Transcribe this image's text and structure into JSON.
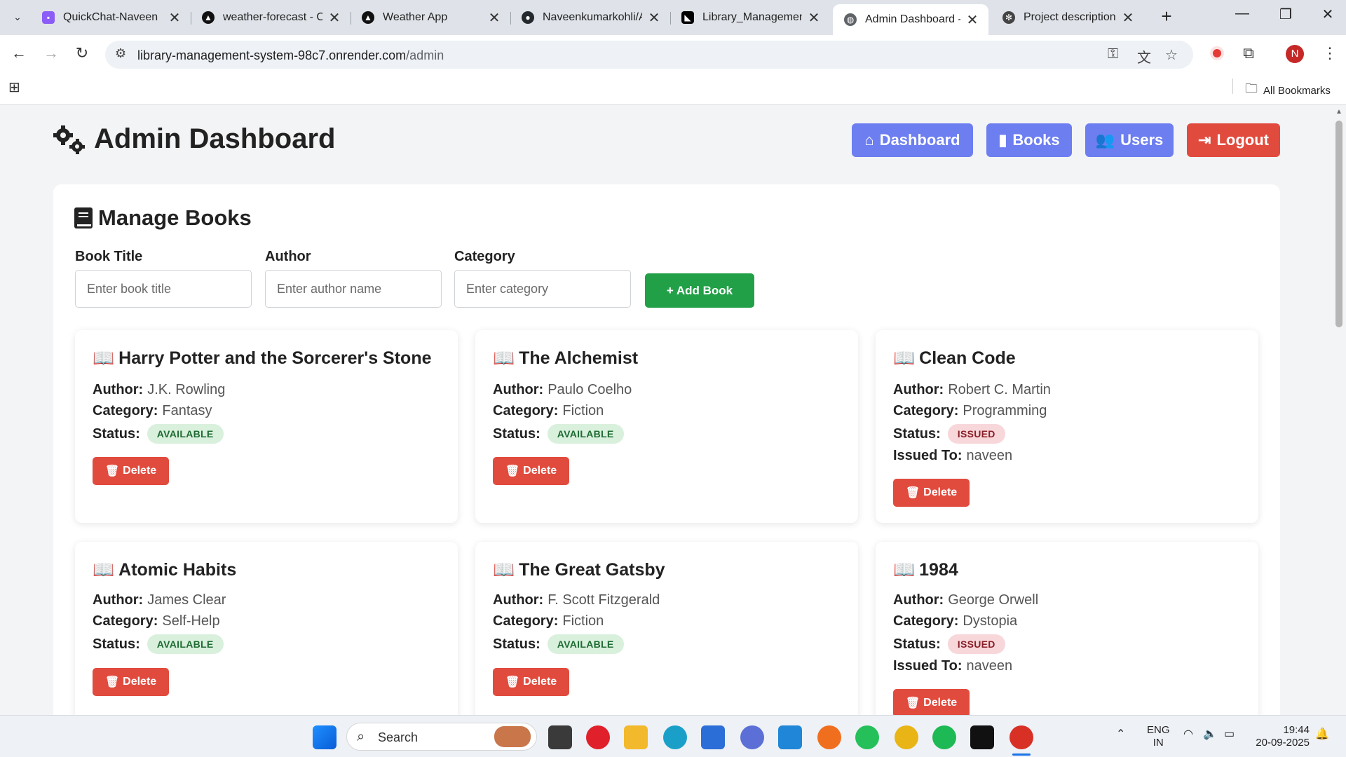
{
  "browser": {
    "tabs": [
      {
        "title": "QuickChat-Naveen",
        "icon": "chat-icon"
      },
      {
        "title": "weather-forecast - O",
        "icon": "vercel-icon"
      },
      {
        "title": "Weather App",
        "icon": "vercel-icon"
      },
      {
        "title": "Naveenkumarkohli/A",
        "icon": "github-icon"
      },
      {
        "title": "Library_Management",
        "icon": "render-icon"
      },
      {
        "title": "Admin Dashboard - L",
        "icon": "globe-icon",
        "active": true
      },
      {
        "title": "Project description re",
        "icon": "openai-icon"
      }
    ],
    "url_host": "library-management-system-98c7.onrender.com",
    "url_path": "/admin",
    "profile_initial": "N",
    "bookmarks_label": "All Bookmarks"
  },
  "header": {
    "title": "Admin Dashboard",
    "nav": {
      "dashboard": "Dashboard",
      "books": "Books",
      "users": "Users",
      "logout": "Logout"
    }
  },
  "manage": {
    "title": "Manage Books",
    "fields": {
      "title_label": "Book Title",
      "title_placeholder": "Enter book title",
      "author_label": "Author",
      "author_placeholder": "Enter author name",
      "category_label": "Category",
      "category_placeholder": "Enter category"
    },
    "add_button": "Add Book",
    "labels": {
      "author": "Author:",
      "category": "Category:",
      "status": "Status:",
      "issued_to": "Issued To:",
      "delete": "Delete"
    },
    "books": [
      {
        "title": "Harry Potter and the Sorcerer's Stone",
        "author": "J.K. Rowling",
        "category": "Fantasy",
        "status": "AVAILABLE"
      },
      {
        "title": "The Alchemist",
        "author": "Paulo Coelho",
        "category": "Fiction",
        "status": "AVAILABLE"
      },
      {
        "title": "Clean Code",
        "author": "Robert C. Martin",
        "category": "Programming",
        "status": "ISSUED",
        "issued_to": "naveen"
      },
      {
        "title": "Atomic Habits",
        "author": "James Clear",
        "category": "Self-Help",
        "status": "AVAILABLE"
      },
      {
        "title": "The Great Gatsby",
        "author": "F. Scott Fitzgerald",
        "category": "Fiction",
        "status": "AVAILABLE"
      },
      {
        "title": "1984",
        "author": "George Orwell",
        "category": "Dystopia",
        "status": "ISSUED",
        "issued_to": "naveen"
      }
    ]
  },
  "taskbar": {
    "search": "Search",
    "lang_top": "ENG",
    "lang_bottom": "IN",
    "time": "19:44",
    "date": "20-09-2025"
  }
}
